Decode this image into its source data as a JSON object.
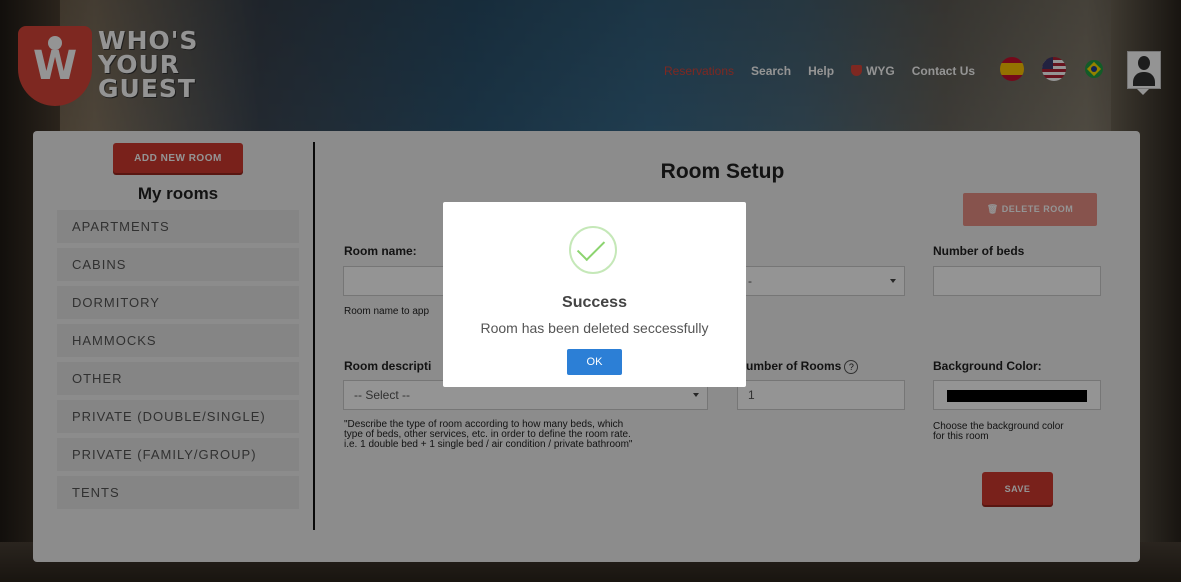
{
  "logo": {
    "line1": "WHO'S",
    "line2": "YOUR",
    "line3": "GUEST"
  },
  "nav": {
    "reservations": "Reservations",
    "search": "Search",
    "help": "Help",
    "wyg": "WYG",
    "contact": "Contact Us"
  },
  "colors": {
    "accent": "#d03a2f",
    "active_nav": "#d9453a",
    "ok_button": "#2c7fd6"
  },
  "sidebar": {
    "add_button": "ADD NEW ROOM",
    "heading": "My rooms",
    "rooms": [
      "APARTMENTS",
      "CABINS",
      "DORMITORY",
      "HAMMOCKS",
      "OTHER",
      "PRIVATE (DOUBLE/SINGLE)",
      "PRIVATE (FAMILY/GROUP)",
      "TENTS"
    ]
  },
  "form": {
    "title": "Room Setup",
    "delete_button": "DELETE ROOM",
    "room_name_label": "Room name:",
    "room_name_value": "",
    "room_name_hint": "Room name to app",
    "room_type_value": "-",
    "beds_label": "Number of beds",
    "beds_value": "",
    "description_label": "Room descripti",
    "description_value": "-- Select --",
    "description_hint_1": "\"Describe the type of room according to how many beds, which",
    "description_hint_2": "type of beds, other services, etc. in order to define the room rate.",
    "description_hint_3": "i.e. 1 double bed + 1 single bed / air condition / private bathroom\"",
    "rooms_label": "umber of Rooms",
    "rooms_value": "1",
    "bg_color_label": "Background Color:",
    "bg_color_value": "#000000",
    "bg_color_hint_1": "Choose the background color",
    "bg_color_hint_2": "for this room",
    "save_button": "SAVE"
  },
  "modal": {
    "title": "Success",
    "message": "Room has been deleted seccessfully",
    "ok": "OK"
  }
}
